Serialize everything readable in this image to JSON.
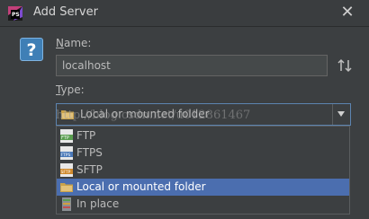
{
  "window": {
    "title": "Add Server",
    "close_glyph": "✕"
  },
  "help": {
    "glyph": "?"
  },
  "name": {
    "label_first": "N",
    "label_rest": "ame:",
    "value": "localhost"
  },
  "type": {
    "label_first": "T",
    "label_rest": "ype:",
    "selected": "Local or mounted folder",
    "options": [
      "FTP",
      "FTPS",
      "SFTP",
      "Local or mounted folder",
      "In place"
    ]
  },
  "watermark": "http://blog.csdn.net/u012861467",
  "colors": {
    "selection": "#4b6eaf",
    "folder": "#c9a24a",
    "ftp_green": "#5a9e4f",
    "ftps_blue": "#4a78b8",
    "sftp_orange": "#d08a2d"
  }
}
